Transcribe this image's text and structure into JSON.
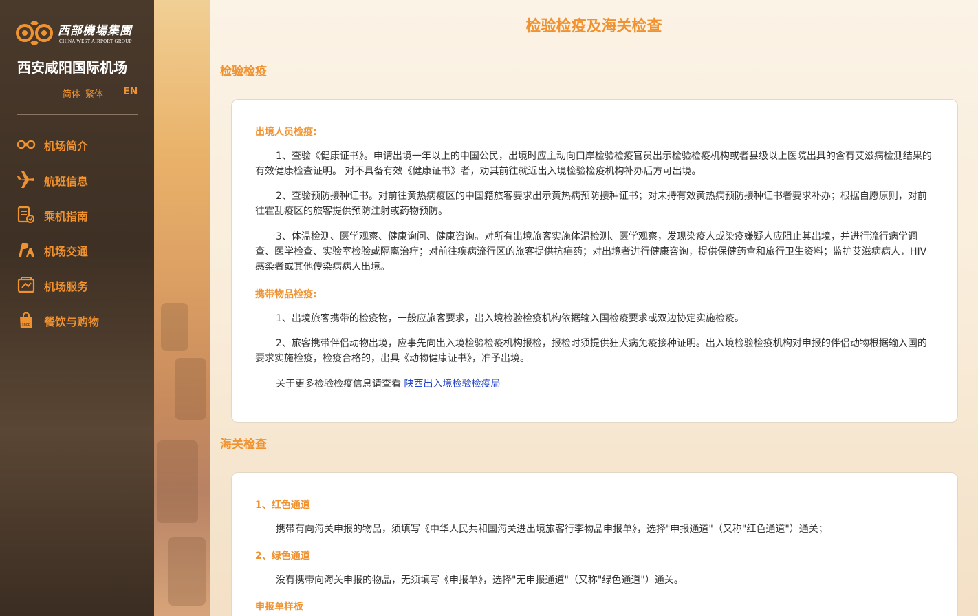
{
  "brand": {
    "name_cn": "西部機場集團",
    "name_en": "CHINA WEST AIRPORT GROUP",
    "airport_name": "西安咸阳国际机场"
  },
  "languages": {
    "simplified": "简体",
    "traditional": "繁体",
    "english": "EN"
  },
  "nav": [
    {
      "label": "机场简介",
      "icon": "airport-logo-icon"
    },
    {
      "label": "航班信息",
      "icon": "airplane-icon"
    },
    {
      "label": "乘机指南",
      "icon": "guide-icon"
    },
    {
      "label": "机场交通",
      "icon": "transport-icon"
    },
    {
      "label": "机场服务",
      "icon": "service-icon"
    },
    {
      "label": "餐饮与购物",
      "icon": "shopping-bag-icon"
    }
  ],
  "colors": {
    "accent": "#f0922f",
    "sidebar_bg": "#3e3024",
    "link": "#2244cc"
  },
  "main": {
    "page_title": "检验检疫及海关检查",
    "quarantine": {
      "title": "检验检疫",
      "exit_heading": "出境人员检疫:",
      "exit_p1": "1、查验《健康证书》。申请出境一年以上的中国公民，出境时应主动向口岸检验检疫官员出示检验检疫机构或者县级以上医院出具的含有艾滋病检测结果的有效健康检查证明。 对不具备有效《健康证书》者，劝其前往就近出入境检验检疫机构补办后方可出境。",
      "exit_p2": "2、查验预防接种证书。对前往黄热病疫区的中国籍旅客要求出示黄热病预防接种证书；对未持有效黄热病预防接种证书者要求补办；根据自愿原则，对前往霍乱疫区的旅客提供预防注射或药物预防。",
      "exit_p3": "3、体温检测、医学观察、健康询问、健康咨询。对所有出境旅客实施体温检测、医学观察，发现染疫人或染疫嫌疑人应阻止其出境，并进行流行病学调查、医学检查、实验室检验或隔离治疗；对前往疾病流行区的旅客提供抗疟药；对出境者进行健康咨询，提供保健药盒和旅行卫生资料；监护艾滋病病人，HIV感染者或其他传染病病人出境。",
      "goods_heading": "携带物品检疫:",
      "goods_p1": "1、出境旅客携带的检疫物，一般应旅客要求，出入境检验检疫机构依据输入国检疫要求或双边协定实施检疫。",
      "goods_p2": "2、旅客携带伴侣动物出境，应事先向出入境检验检疫机构报检，报检时须提供狂犬病免疫接种证明。出入境检验检疫机构对申报的伴侣动物根据输入国的要求实施检疫，检疫合格的，出具《动物健康证书》，准予出境。",
      "more_text": "关于更多检验检疫信息请查看",
      "more_link": "陕西出入境检验检疫局"
    },
    "customs": {
      "title": "海关检查",
      "red_heading": "1、红色通道",
      "red_p": "携带有向海关申报的物品，须填写《中华人民共和国海关进出境旅客行李物品申报单》，选择\"申报通道\"（又称\"红色通道\"）通关；",
      "green_heading": "2、绿色通道",
      "green_p": "没有携带向海关申报的物品，无须填写《申报单》，选择\"无申报通道\"（又称\"绿色通道\"）通关。",
      "sample_heading": "申报单样板"
    }
  }
}
